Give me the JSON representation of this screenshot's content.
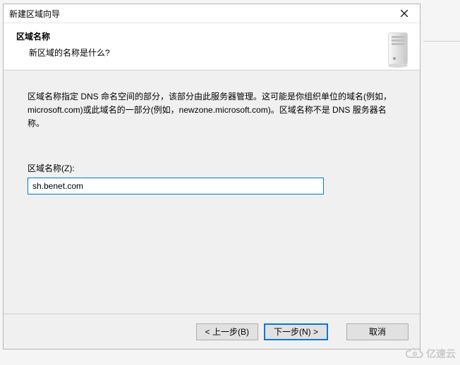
{
  "titlebar": {
    "title": "新建区域向导"
  },
  "header": {
    "title": "区域名称",
    "subtitle": "新区域的名称是什么?"
  },
  "content": {
    "description": "区域名称指定 DNS 命名空间的部分，该部分由此服务器管理。这可能是你组织单位的域名(例如，microsoft.com)或此域名的一部分(例如，newzone.microsoft.com)。区域名称不是 DNS 服务器名称。",
    "field_label": "区域名称(Z):",
    "field_value": "sh.benet.com"
  },
  "buttons": {
    "back": "< 上一步(B)",
    "next": "下一步(N) >",
    "cancel": "取消"
  },
  "watermark": {
    "text": "亿速云"
  }
}
